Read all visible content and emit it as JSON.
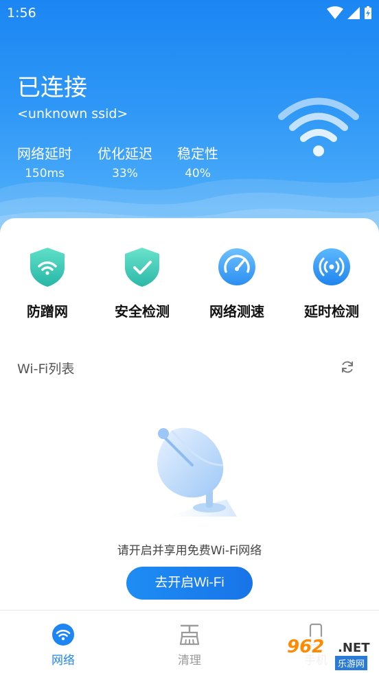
{
  "status_bar": {
    "time": "1:56"
  },
  "header": {
    "connection_status": "已连接",
    "ssid": "<unknown ssid>",
    "stats": [
      {
        "label": "网络延时",
        "value": "150ms"
      },
      {
        "label": "优化延迟",
        "value": "33%"
      },
      {
        "label": "稳定性",
        "value": "40%"
      }
    ]
  },
  "features": [
    {
      "label": "防蹭网",
      "icon": "shield-wifi-icon"
    },
    {
      "label": "安全检测",
      "icon": "shield-check-icon"
    },
    {
      "label": "网络测速",
      "icon": "speedometer-icon"
    },
    {
      "label": "延时检测",
      "icon": "signal-broadcast-icon"
    }
  ],
  "wifi_list": {
    "title": "Wi-Fi列表",
    "empty_message": "请开启并享用免费Wi-Fi网络",
    "open_button": "去开启Wi-Fi"
  },
  "tabbar": {
    "tabs": [
      {
        "label": "网络",
        "active": true,
        "icon": "wifi-icon"
      },
      {
        "label": "清理",
        "active": false,
        "icon": "broom-icon"
      },
      {
        "label": "手机",
        "active": false,
        "icon": "phone-icon"
      }
    ]
  },
  "watermark": {
    "brand": "962",
    "suffix": ".NET",
    "sub": "乐游网"
  },
  "colors": {
    "primary": "#1b86f3",
    "accent_button": "#1874e8",
    "active_tab": "#1e86f2",
    "inactive_tab": "#9a9a9a"
  }
}
